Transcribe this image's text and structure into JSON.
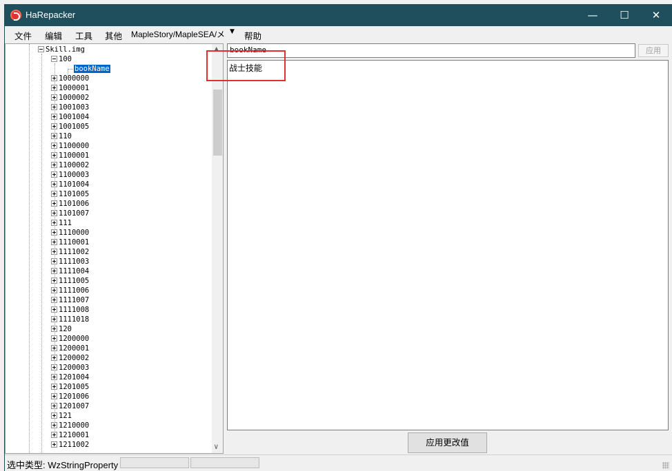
{
  "window": {
    "title": "HaRepacker",
    "minimize": "—",
    "maximize": "☐",
    "close": "✕"
  },
  "menu": {
    "file": "文件",
    "edit": "编辑",
    "tools": "工具",
    "other": "其他",
    "path": "MapleStory/MapleSEA/メ",
    "help": "帮助"
  },
  "tree": {
    "root": "Skill.img",
    "expanded": "100",
    "selected": "bookName",
    "items": [
      "1000000",
      "1000001",
      "1000002",
      "1001003",
      "1001004",
      "1001005",
      "110",
      "1100000",
      "1100001",
      "1100002",
      "1100003",
      "1101004",
      "1101005",
      "1101006",
      "1101007",
      "111",
      "1110000",
      "1110001",
      "1111002",
      "1111003",
      "1111004",
      "1111005",
      "1111006",
      "1111007",
      "1111008",
      "1111018",
      "120",
      "1200000",
      "1200001",
      "1200002",
      "1200003",
      "1201004",
      "1201005",
      "1201006",
      "1201007",
      "121",
      "1210000",
      "1210001",
      "1211002"
    ]
  },
  "editor": {
    "name_value": "bookName",
    "apply_small": "应用",
    "value_text": "战士技能",
    "apply_button": "应用更改值"
  },
  "status": {
    "text": "选中类型: WzStringProperty"
  },
  "colors": {
    "titlebar": "#1f4f5c",
    "highlight": "#e0302a",
    "selection": "#0066cc"
  }
}
